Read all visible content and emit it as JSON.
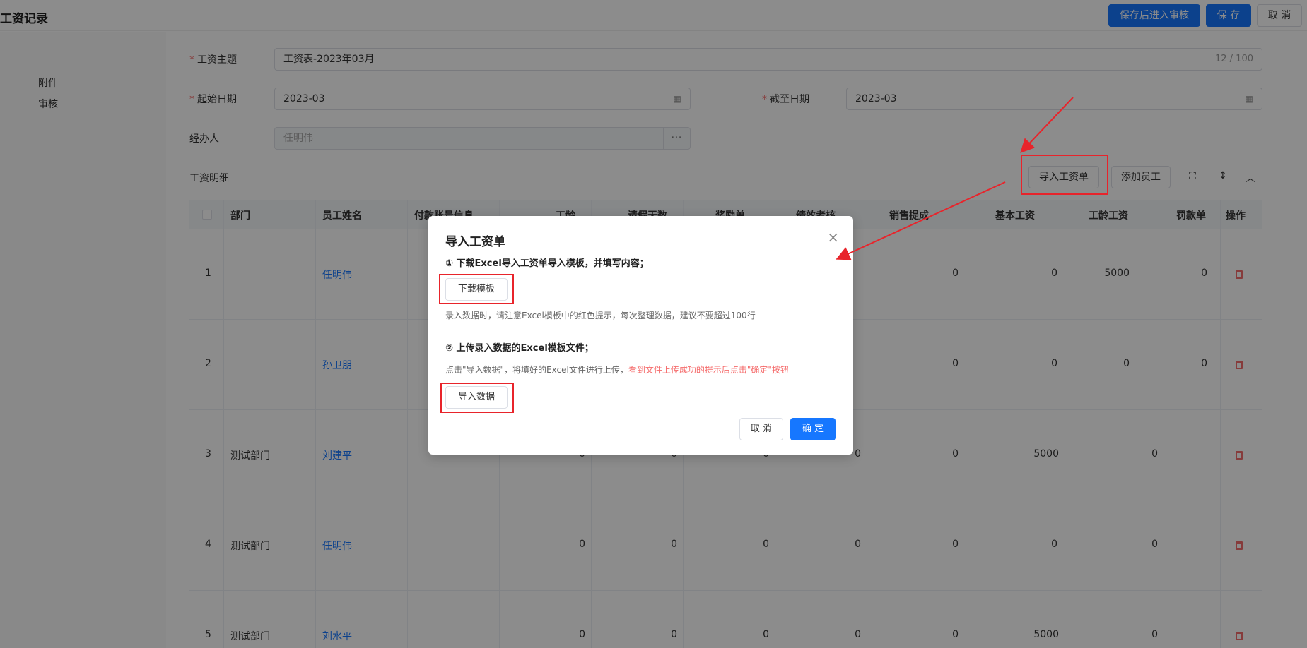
{
  "page": {
    "title": "工资记录",
    "submit_review_label": "保存后进入审核",
    "save_label": "保 存",
    "cancel_label": "取 消"
  },
  "sidebar": {
    "items": [
      {
        "label": "附件"
      },
      {
        "label": "审核"
      }
    ]
  },
  "form": {
    "subject_label": "工资主题",
    "subject_value": "工资表-2023年03月",
    "subject_count": "12 / 100",
    "start_label": "起始日期",
    "start_value": "2023-03",
    "end_label": "截至日期",
    "end_value": "2023-03",
    "handler_label": "经办人",
    "handler_value": "任明伟",
    "handler_dots": "···"
  },
  "detail": {
    "title": "工资明细",
    "import_label": "导入工资单",
    "add_employee_label": "添加员工"
  },
  "table": {
    "columns": [
      "部门",
      "员工姓名",
      "付款账号信息",
      "工龄",
      "请假天数",
      "奖励单",
      "绩效考核",
      "销售提成",
      "基本工资",
      "工龄工资",
      "罚款单",
      "操作"
    ],
    "rows": [
      {
        "index": "1",
        "dept": "",
        "name": "任明伟",
        "c1": "",
        "c2": "",
        "c3": "",
        "c4": "0",
        "c5": "0",
        "c6": "5000",
        "c7": "0"
      },
      {
        "index": "2",
        "dept": "",
        "name": "孙卫朋",
        "c1": "",
        "c2": "",
        "c3": "",
        "c4": "0",
        "c5": "0",
        "c6": "0",
        "c7": "0"
      },
      {
        "index": "3",
        "dept": "测试部门",
        "name": "刘建平",
        "c1": "0",
        "c2": "0",
        "c3": "0",
        "c4": "0",
        "c5": "0",
        "c6": "5000",
        "c7": "0"
      },
      {
        "index": "4",
        "dept": "测试部门",
        "name": "任明伟",
        "c1": "0",
        "c2": "0",
        "c3": "0",
        "c4": "0",
        "c5": "0",
        "c6": "0",
        "c7": "0"
      },
      {
        "index": "5",
        "dept": "测试部门",
        "name": "刘水平",
        "c1": "0",
        "c2": "0",
        "c3": "0",
        "c4": "0",
        "c5": "0",
        "c6": "5000",
        "c7": "0"
      }
    ]
  },
  "modal": {
    "title": "导入工资单",
    "close": "×",
    "step1": "① 下载Excel导入工资单导入模板，并填写内容；",
    "download_label": "下载模板",
    "note1": "录入数据时，请注意Excel模板中的红色提示，每次整理数据，建议不要超过100行",
    "step2": "② 上传录入数据的Excel模板文件；",
    "note2": "点击\"导入数据\"，将填好的Excel文件进行上传，",
    "note2_red": "看到文件上传成功的提示后点击\"确定\"按钮",
    "import_data_label": "导入数据",
    "cancel_label": "取 消",
    "ok_label": "确 定"
  },
  "colors": {
    "primary": "#1677ff",
    "danger": "#f56c6c",
    "annotation": "#e8242b"
  }
}
